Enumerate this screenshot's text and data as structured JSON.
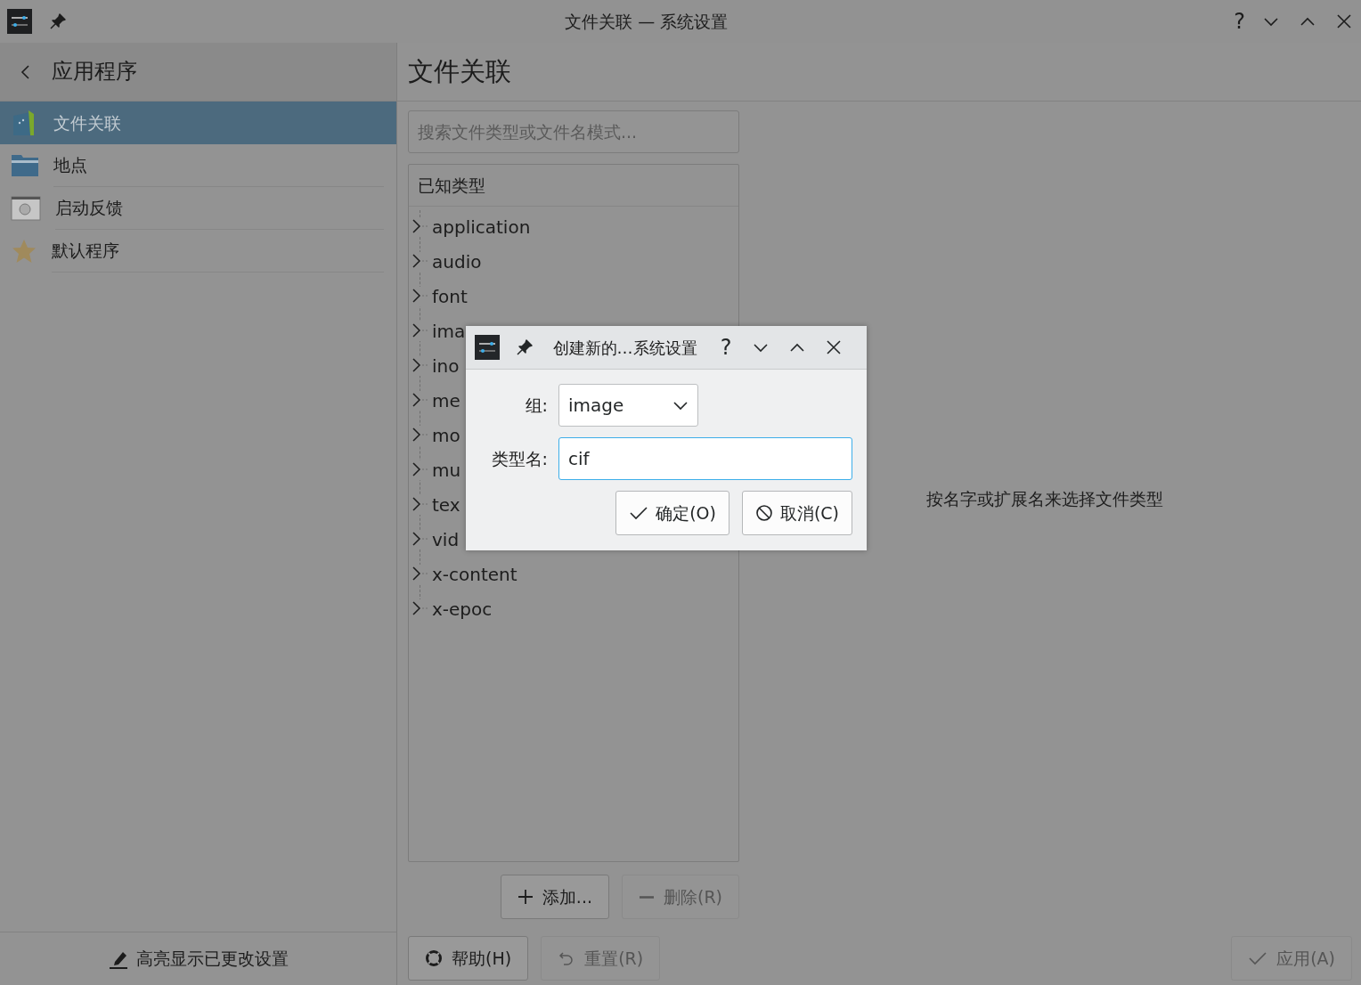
{
  "window": {
    "title": "文件关联 — 系统设置",
    "help": "?"
  },
  "sidebar": {
    "title": "应用程序",
    "items": [
      {
        "label": "文件关联",
        "selected": true
      },
      {
        "label": "地点",
        "selected": false
      },
      {
        "label": "启动反馈",
        "selected": false
      },
      {
        "label": "默认程序",
        "selected": false
      }
    ],
    "footer_button": "高亮显示已更改设置"
  },
  "page": {
    "heading": "文件关联",
    "search": {
      "placeholder": "搜索文件类型或文件名模式..."
    },
    "tree": {
      "header": "已知类型",
      "items": [
        {
          "label": "application",
          "expanded": false
        },
        {
          "label": "audio",
          "expanded": false
        },
        {
          "label": "font",
          "expanded": false
        },
        {
          "label": "ima",
          "expanded": false
        },
        {
          "label": "ino",
          "expanded": false
        },
        {
          "label": "me",
          "expanded": false
        },
        {
          "label": "mo",
          "expanded": false
        },
        {
          "label": "mu",
          "expanded": false
        },
        {
          "label": "tex",
          "expanded": false
        },
        {
          "label": "vid",
          "expanded": false
        },
        {
          "label": "x-content",
          "expanded": false
        },
        {
          "label": "x-epoc",
          "expanded": false
        }
      ]
    },
    "add_button": {
      "label": "添加...",
      "disabled": false
    },
    "remove_button": {
      "label": "删除(R)",
      "disabled": true
    },
    "hint": "按名字或扩展名来选择文件类型"
  },
  "buttons": [
    {
      "kind": "help",
      "label": "帮助(H)",
      "disabled": false
    },
    {
      "kind": "reset",
      "label": "重置(R)",
      "disabled": true
    },
    {
      "kind": "apply",
      "label": "应用(A)",
      "disabled": true
    }
  ],
  "dialog": {
    "title": "创建新的…系统设置",
    "help": "?",
    "group_label": "组:",
    "group_value": "image",
    "type_label": "类型名:",
    "type_value": "cif",
    "ok": "确定(O)",
    "cancel": "取消(C)"
  }
}
